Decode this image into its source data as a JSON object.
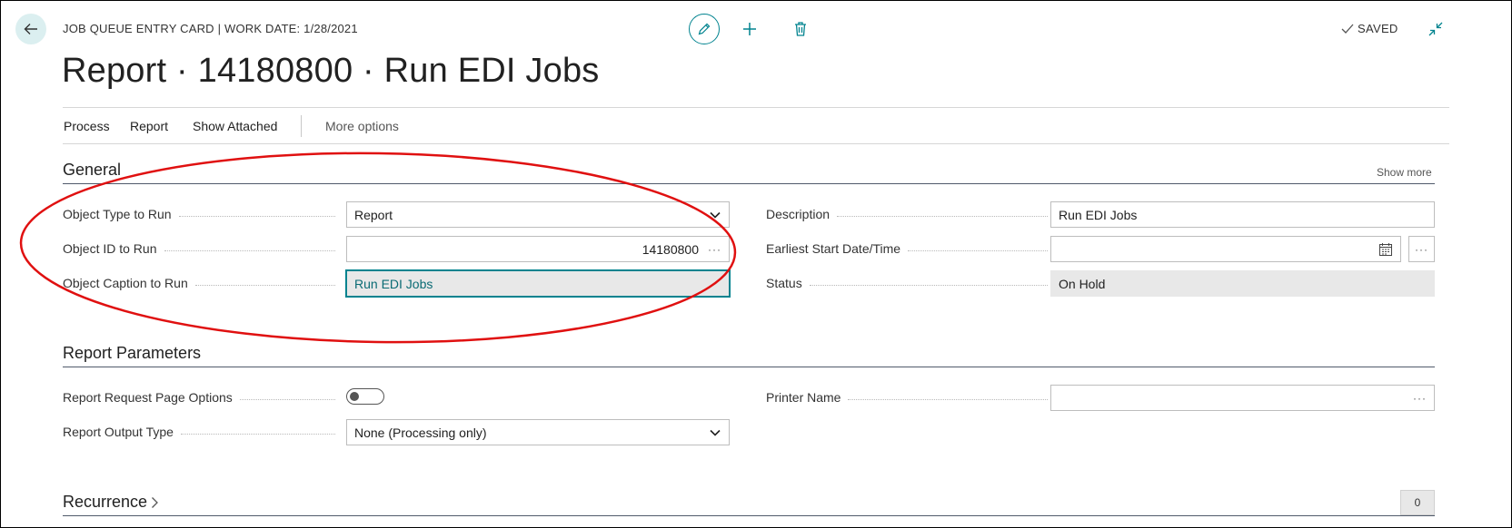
{
  "header": {
    "breadcrumb": "JOB QUEUE ENTRY CARD | WORK DATE: 1/28/2021",
    "title": "Report · 14180800 · Run EDI Jobs",
    "status": "SAVED",
    "icons": {
      "back": "back-arrow-icon",
      "edit": "pencil-icon",
      "add": "plus-icon",
      "delete": "trash-icon",
      "saved": "check-icon",
      "collapse": "collapse-icon"
    }
  },
  "actions": {
    "items": [
      "Process",
      "Report",
      "Show Attached"
    ],
    "more": "More options"
  },
  "general": {
    "title": "General",
    "show_more": "Show more",
    "left": [
      {
        "label": "Object Type to Run",
        "value": "Report"
      },
      {
        "label": "Object ID to Run",
        "value": "14180800"
      },
      {
        "label": "Object Caption to Run",
        "value": "Run EDI Jobs"
      }
    ],
    "right": [
      {
        "label": "Description",
        "value": "Run EDI Jobs"
      },
      {
        "label": "Earliest Start Date/Time",
        "value": ""
      },
      {
        "label": "Status",
        "value": "On Hold"
      }
    ]
  },
  "report_parameters": {
    "title": "Report Parameters",
    "request_page_label": "Report Request Page Options",
    "request_page_enabled": false,
    "output_type_label": "Report Output Type",
    "output_type_value": "None (Processing only)",
    "printer_label": "Printer Name",
    "printer_value": ""
  },
  "recurrence": {
    "title": "Recurrence",
    "count": "0"
  },
  "colors": {
    "accent": "#00838f",
    "annotation": "#e01010",
    "readonly_bg": "#e8e8e8"
  },
  "ellipsis_glyph": "···"
}
